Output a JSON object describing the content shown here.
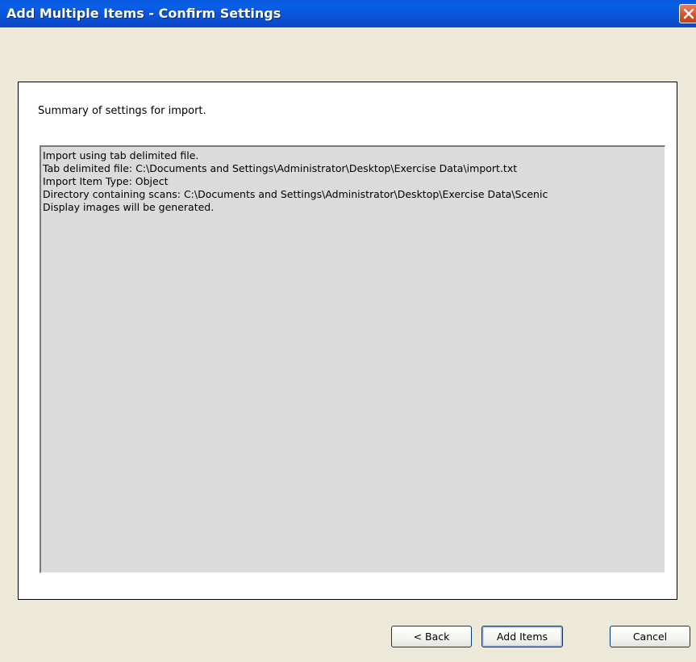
{
  "window": {
    "title": "Add Multiple Items - Confirm Settings",
    "close_icon": "close-icon"
  },
  "panel": {
    "summary_label": "Summary of settings for import.",
    "summary_lines": [
      "Import using tab delimited file.",
      "Tab delimited file: C:\\Documents and Settings\\Administrator\\Desktop\\Exercise Data\\import.txt",
      "Import Item Type: Object",
      "Directory containing scans: C:\\Documents and Settings\\Administrator\\Desktop\\Exercise Data\\Scenic",
      "Display images will be generated."
    ]
  },
  "buttons": {
    "back_label": "< Back",
    "add_items_label": "Add Items",
    "cancel_label": "Cancel"
  },
  "colors": {
    "titlebar": "#0a58de",
    "window_bg": "#ece9d8",
    "summary_bg": "#dadbda",
    "close_button": "#d4532d"
  }
}
